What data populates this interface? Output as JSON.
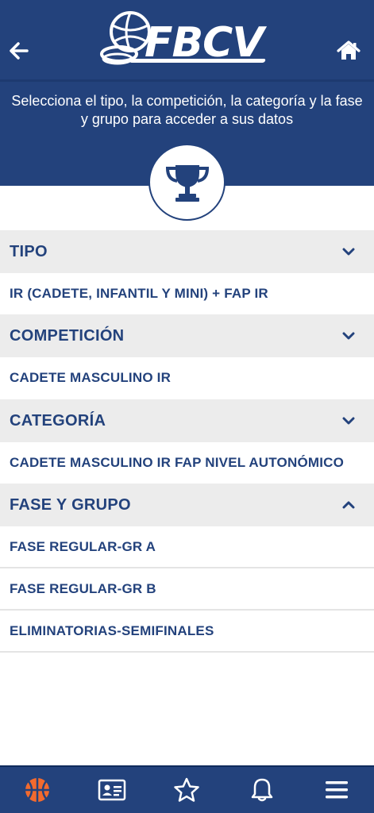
{
  "header": {
    "logo_text": "FBCV",
    "subtitle": "Selecciona el tipo, la competición, la categoría y la fase y grupo para acceder a sus datos"
  },
  "icons": {
    "back": "arrow-left-icon",
    "home": "home-icon",
    "trophy": "trophy-icon",
    "nav": [
      "basketball-icon",
      "id-card-icon",
      "star-icon",
      "bell-icon",
      "menu-icon"
    ]
  },
  "colors": {
    "primary": "#23427c",
    "section_bg": "#ececec",
    "active_nav": "#f26a2e"
  },
  "sections": [
    {
      "title": "TIPO",
      "expanded": false,
      "items": [
        "IR (CADETE, INFANTIL Y MINI) + FAP IR"
      ]
    },
    {
      "title": "COMPETICIÓN",
      "expanded": false,
      "items": [
        "CADETE MASCULINO IR"
      ]
    },
    {
      "title": "CATEGORÍA",
      "expanded": false,
      "items": [
        "CADETE MASCULINO IR FAP NIVEL AUTONÓMICO"
      ]
    },
    {
      "title": "FASE Y GRUPO",
      "expanded": true,
      "items": [
        "FASE REGULAR-GR A",
        "FASE REGULAR-GR B",
        "ELIMINATORIAS-SEMIFINALES"
      ]
    }
  ]
}
